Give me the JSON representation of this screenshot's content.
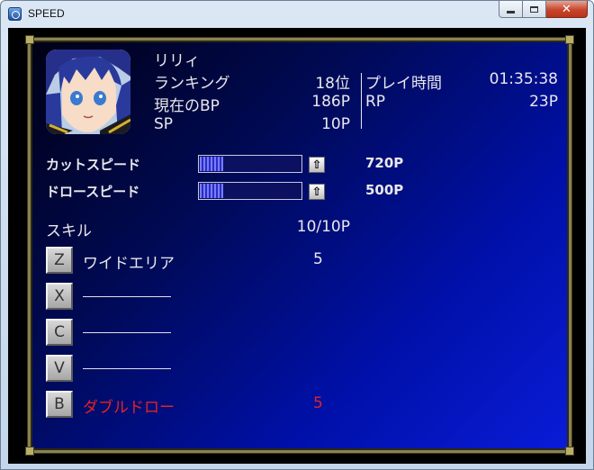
{
  "window": {
    "title": "SPEED"
  },
  "character": {
    "name": "リリィ",
    "ranking_label": "ランキング",
    "ranking_value": "18位",
    "bp_label": "現在のBP",
    "bp_value": "186P",
    "sp_label": "SP",
    "sp_value": "10P",
    "playtime_label": "プレイ時間",
    "playtime_value": "01:35:38",
    "rp_label": "RP",
    "rp_value": "23P"
  },
  "stats": [
    {
      "label": "カットスピード",
      "value": "720P",
      "gauge_fraction": 0.23
    },
    {
      "label": "ドロースピード",
      "value": "500P",
      "gauge_fraction": 0.23
    }
  ],
  "skills": {
    "header": "スキル",
    "capacity": "10/10P",
    "slots": [
      {
        "key": "Z",
        "name": "ワイドエリア",
        "cost": "5",
        "color": "#e8e8ec"
      },
      {
        "key": "X",
        "name": "",
        "cost": ""
      },
      {
        "key": "C",
        "name": "",
        "cost": ""
      },
      {
        "key": "V",
        "name": "",
        "cost": ""
      },
      {
        "key": "B",
        "name": "ダブルドロー",
        "cost": "5",
        "color": "#e02424"
      }
    ]
  },
  "icons": {
    "up_arrow": "⇧",
    "close": "✕"
  }
}
